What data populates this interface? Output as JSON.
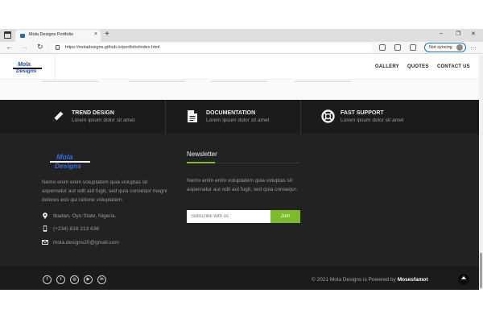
{
  "browser": {
    "tab_title": "Mola Designs Portfolio",
    "tab_close": "×",
    "new_tab": "+",
    "url": "https://moladesigns.github.io/portfolio/index.html",
    "sync_label": "Not syncing",
    "window_controls": [
      "–",
      "❐",
      "✕"
    ],
    "nav_glyphs": {
      "back": "←",
      "forward": "→",
      "refresh": "↻"
    },
    "more_label": "…"
  },
  "header": {
    "logo_top": "Mola",
    "logo_bottom": "Designs",
    "nav": [
      "GALLERY",
      "QUOTES",
      "CONTACT US"
    ]
  },
  "features": [
    {
      "icon": "pen-icon",
      "title": "TREND DESIGN",
      "text": "Lorem ipsum dolor sit amet"
    },
    {
      "icon": "document-icon",
      "title": "DOCUMENTATION",
      "text": "Lorem ipsum dolor sit amet"
    },
    {
      "icon": "lifebuoy-icon",
      "title": "FAST SUPPORT",
      "text": "Lorem ipsum dolor sit amet"
    }
  ],
  "footer": {
    "logo_top": "Mola",
    "logo_bottom": "Designs",
    "about": "Nemo enim enim voluptatem quia voluptas sit aspernatur aut odit aut fugit, sed quia consequr magni dolores eos qui ratione voluptatem.",
    "address": "Ibadan, Oyo State, Nigeria.",
    "phone": "(+234) 816 213 638",
    "email": "mola.designs20@gmail.com",
    "newsletter_title": "Newsletter",
    "newsletter_text": "Nemo enim enim voluptatem quia voluptas sit aspernatur aut odit aut fugit, sed quia consequr.",
    "subscribe_placeholder": "Subscribe with us",
    "join_label": "Join"
  },
  "bottom": {
    "copyright_prefix": "© 2021 Mola Designs is Powered by ",
    "copyright_author": "Mosesfamot",
    "social": [
      {
        "icon": "facebook-icon",
        "glyph": "f"
      },
      {
        "icon": "twitter-icon",
        "glyph": "t"
      },
      {
        "icon": "instagram-icon",
        "glyph": "◎"
      },
      {
        "icon": "youtube-icon",
        "glyph": "▶"
      },
      {
        "icon": "linkedin-icon",
        "glyph": "in"
      }
    ]
  },
  "colors": {
    "accent_green": "#7dbb2a",
    "logo_blue": "#2f6fe0",
    "footer_bg": "#222222",
    "band_bg": "#1b1b1b"
  }
}
